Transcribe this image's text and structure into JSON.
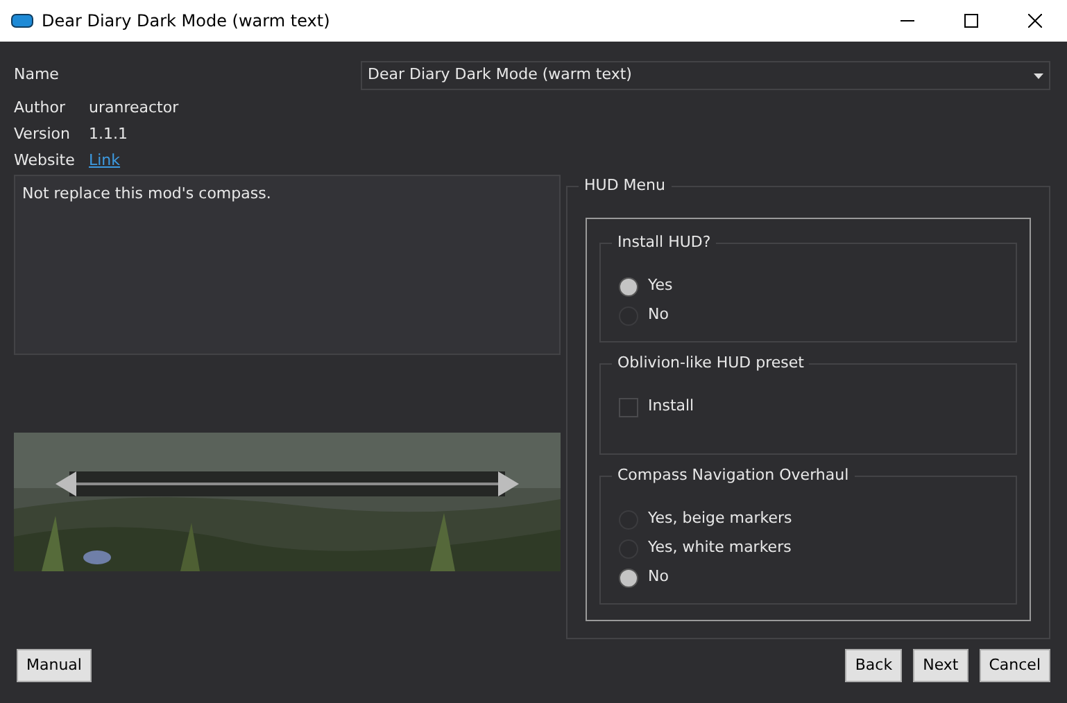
{
  "window": {
    "title": "Dear Diary Dark Mode (warm text)"
  },
  "name_field": {
    "label": "Name",
    "value": "Dear Diary Dark Mode (warm text)"
  },
  "info": [
    {
      "label": "Author",
      "value": "uranreactor",
      "kind": "text"
    },
    {
      "label": "Version",
      "value": "1.1.1",
      "kind": "text"
    },
    {
      "label": "Website",
      "value": "Link",
      "kind": "link"
    }
  ],
  "description": "Not replace this mod's compass.",
  "preview": {
    "kind": "picture"
  },
  "hud_menu": {
    "title": "HUD Menu",
    "groups": [
      {
        "title": "Install HUD?",
        "options": [
          {
            "kind": "radio",
            "label": "Yes",
            "selected": true
          },
          {
            "kind": "radio",
            "label": "No",
            "selected": false
          }
        ]
      },
      {
        "title": "Oblivion-like HUD preset",
        "options": [
          {
            "kind": "checkbox",
            "label": "Install",
            "selected": false
          }
        ]
      },
      {
        "title": "Compass Navigation Overhaul",
        "options": [
          {
            "kind": "radio",
            "label": "Yes, beige markers",
            "selected": false
          },
          {
            "kind": "radio",
            "label": "Yes, white markers",
            "selected": false
          },
          {
            "kind": "radio",
            "label": "No",
            "selected": true
          }
        ]
      }
    ]
  },
  "buttons_left": [
    "Manual"
  ],
  "buttons_right": [
    "Back",
    "Next",
    "Cancel"
  ]
}
